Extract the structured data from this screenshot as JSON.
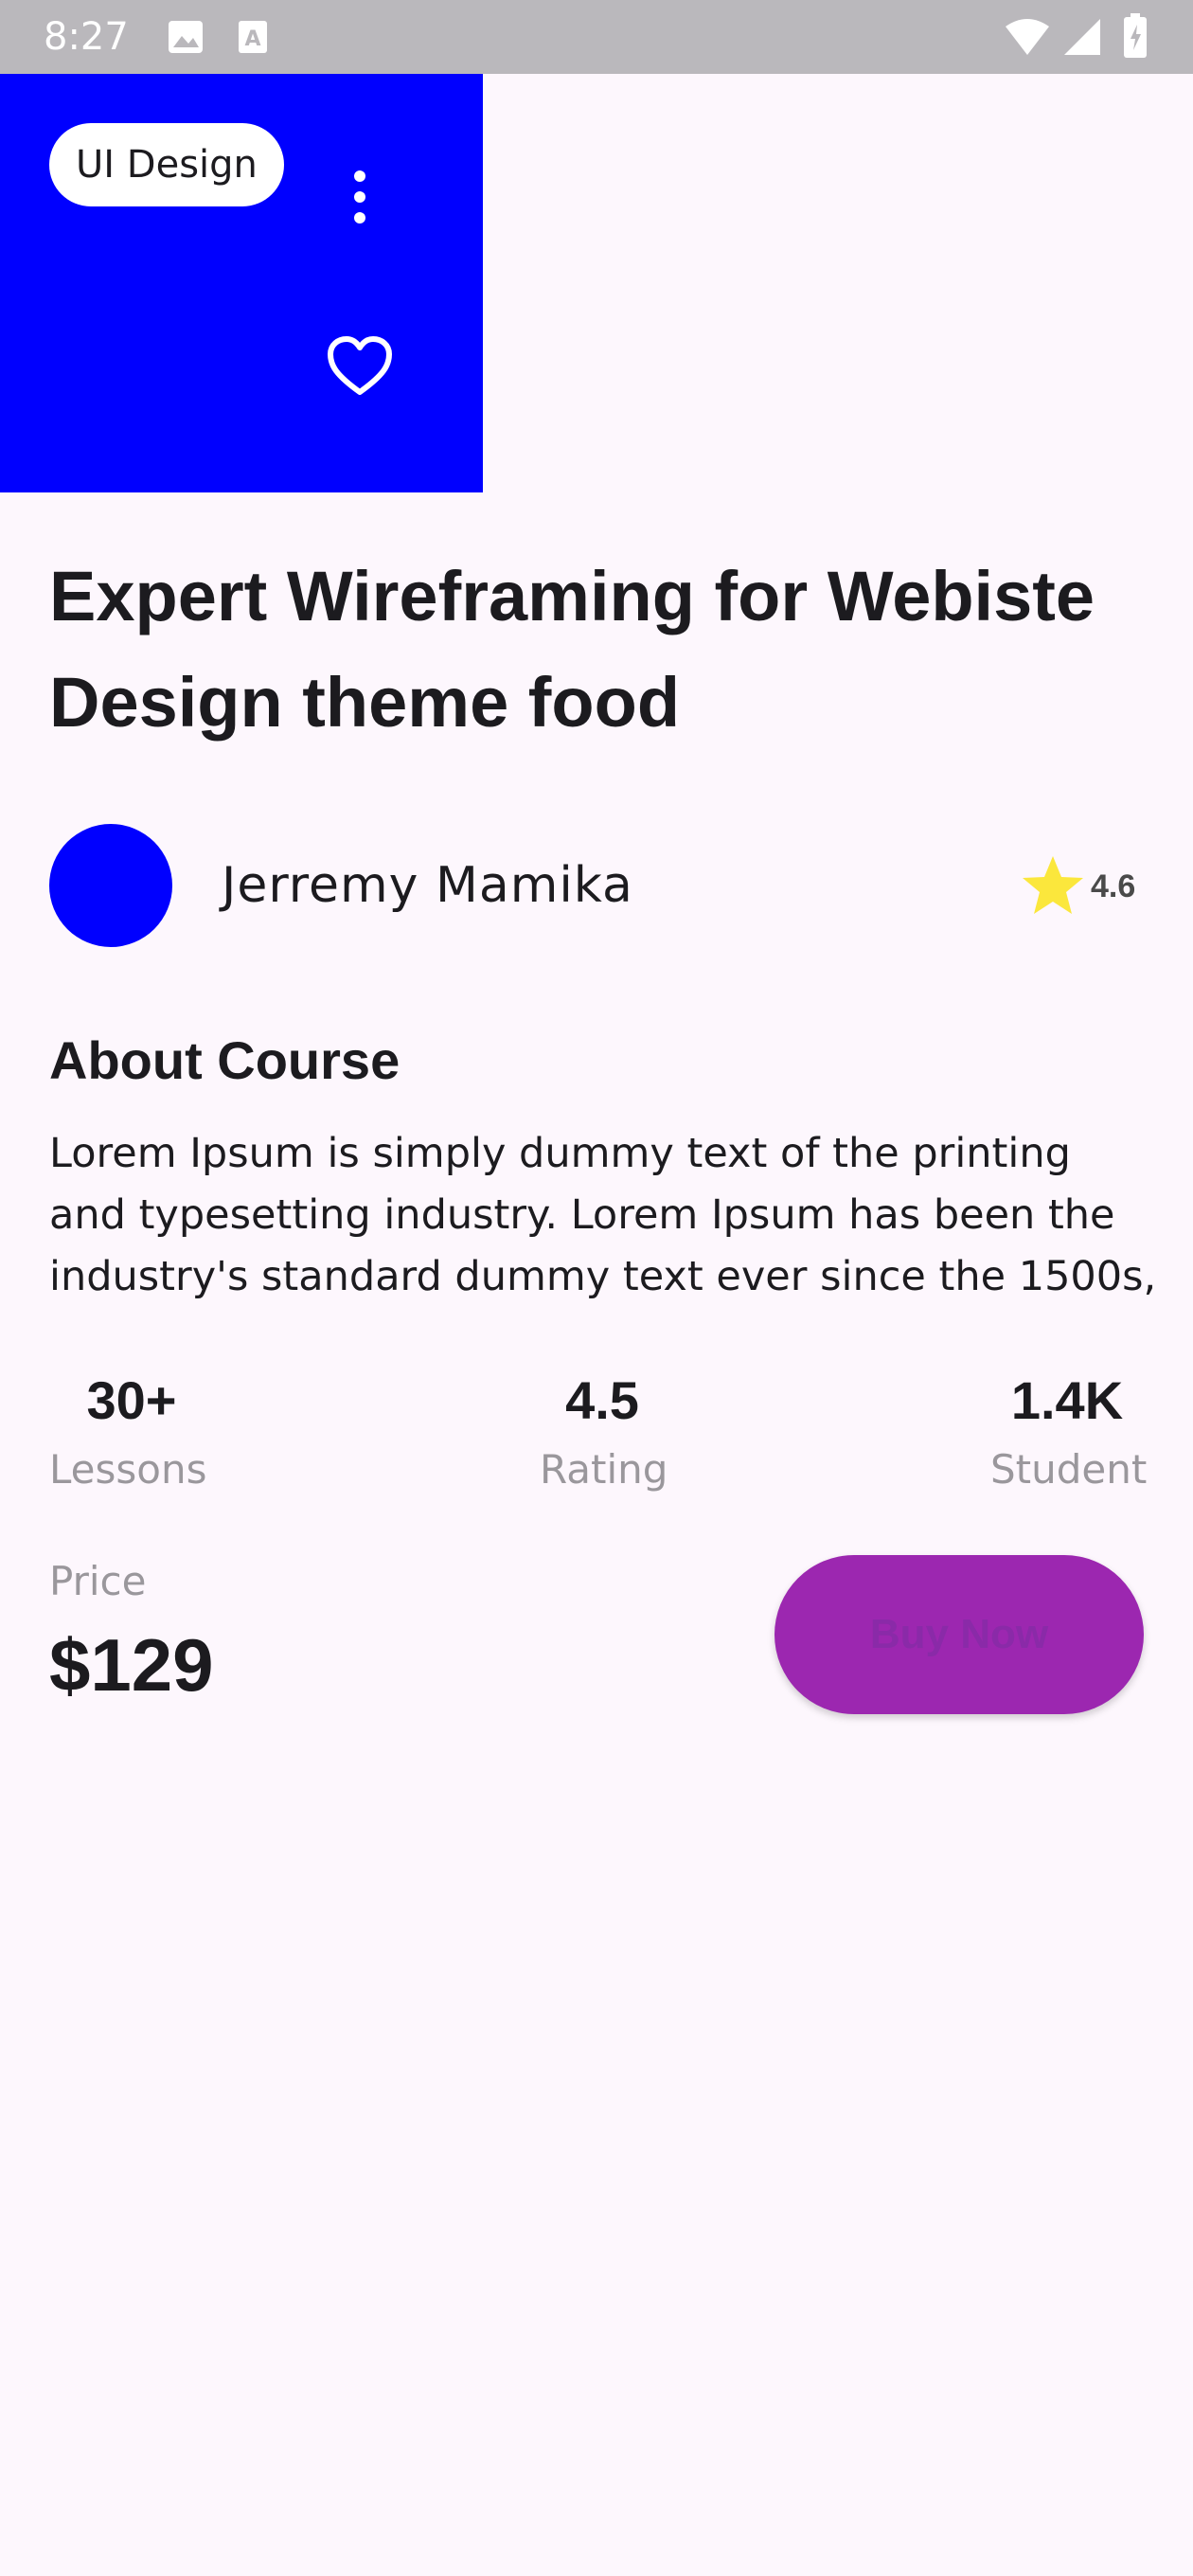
{
  "status_bar": {
    "time": "8:27",
    "icons": [
      "image-icon",
      "text-a-icon",
      "wifi-icon",
      "signal-icon",
      "battery-icon"
    ]
  },
  "hero": {
    "background_color": "#0000ff",
    "category_chip": "UI Design",
    "icons": [
      "more-vert-icon",
      "heart-outline-icon"
    ]
  },
  "course": {
    "title": "Expert Wireframing for Webiste Design theme food"
  },
  "author": {
    "name": "Jerremy Mamika",
    "rating": "4.6",
    "avatar_color": "#0000ff",
    "star_color": "#fbe73c"
  },
  "about": {
    "heading": "About Course",
    "text": "Lorem Ipsum is simply dummy text of the printing and typesetting industry. Lorem Ipsum has been the industry's standard dummy text ever since the 1500s,"
  },
  "stats": {
    "lessons": {
      "value": "30+",
      "label": "Lessons"
    },
    "rating": {
      "value": "4.5",
      "label": "Rating"
    },
    "students": {
      "value": "1.4K",
      "label": "Student"
    }
  },
  "purchase": {
    "price_label": "Price",
    "price": "$129",
    "buy_label": "Buy Now",
    "button_color": "#9c27b0"
  }
}
